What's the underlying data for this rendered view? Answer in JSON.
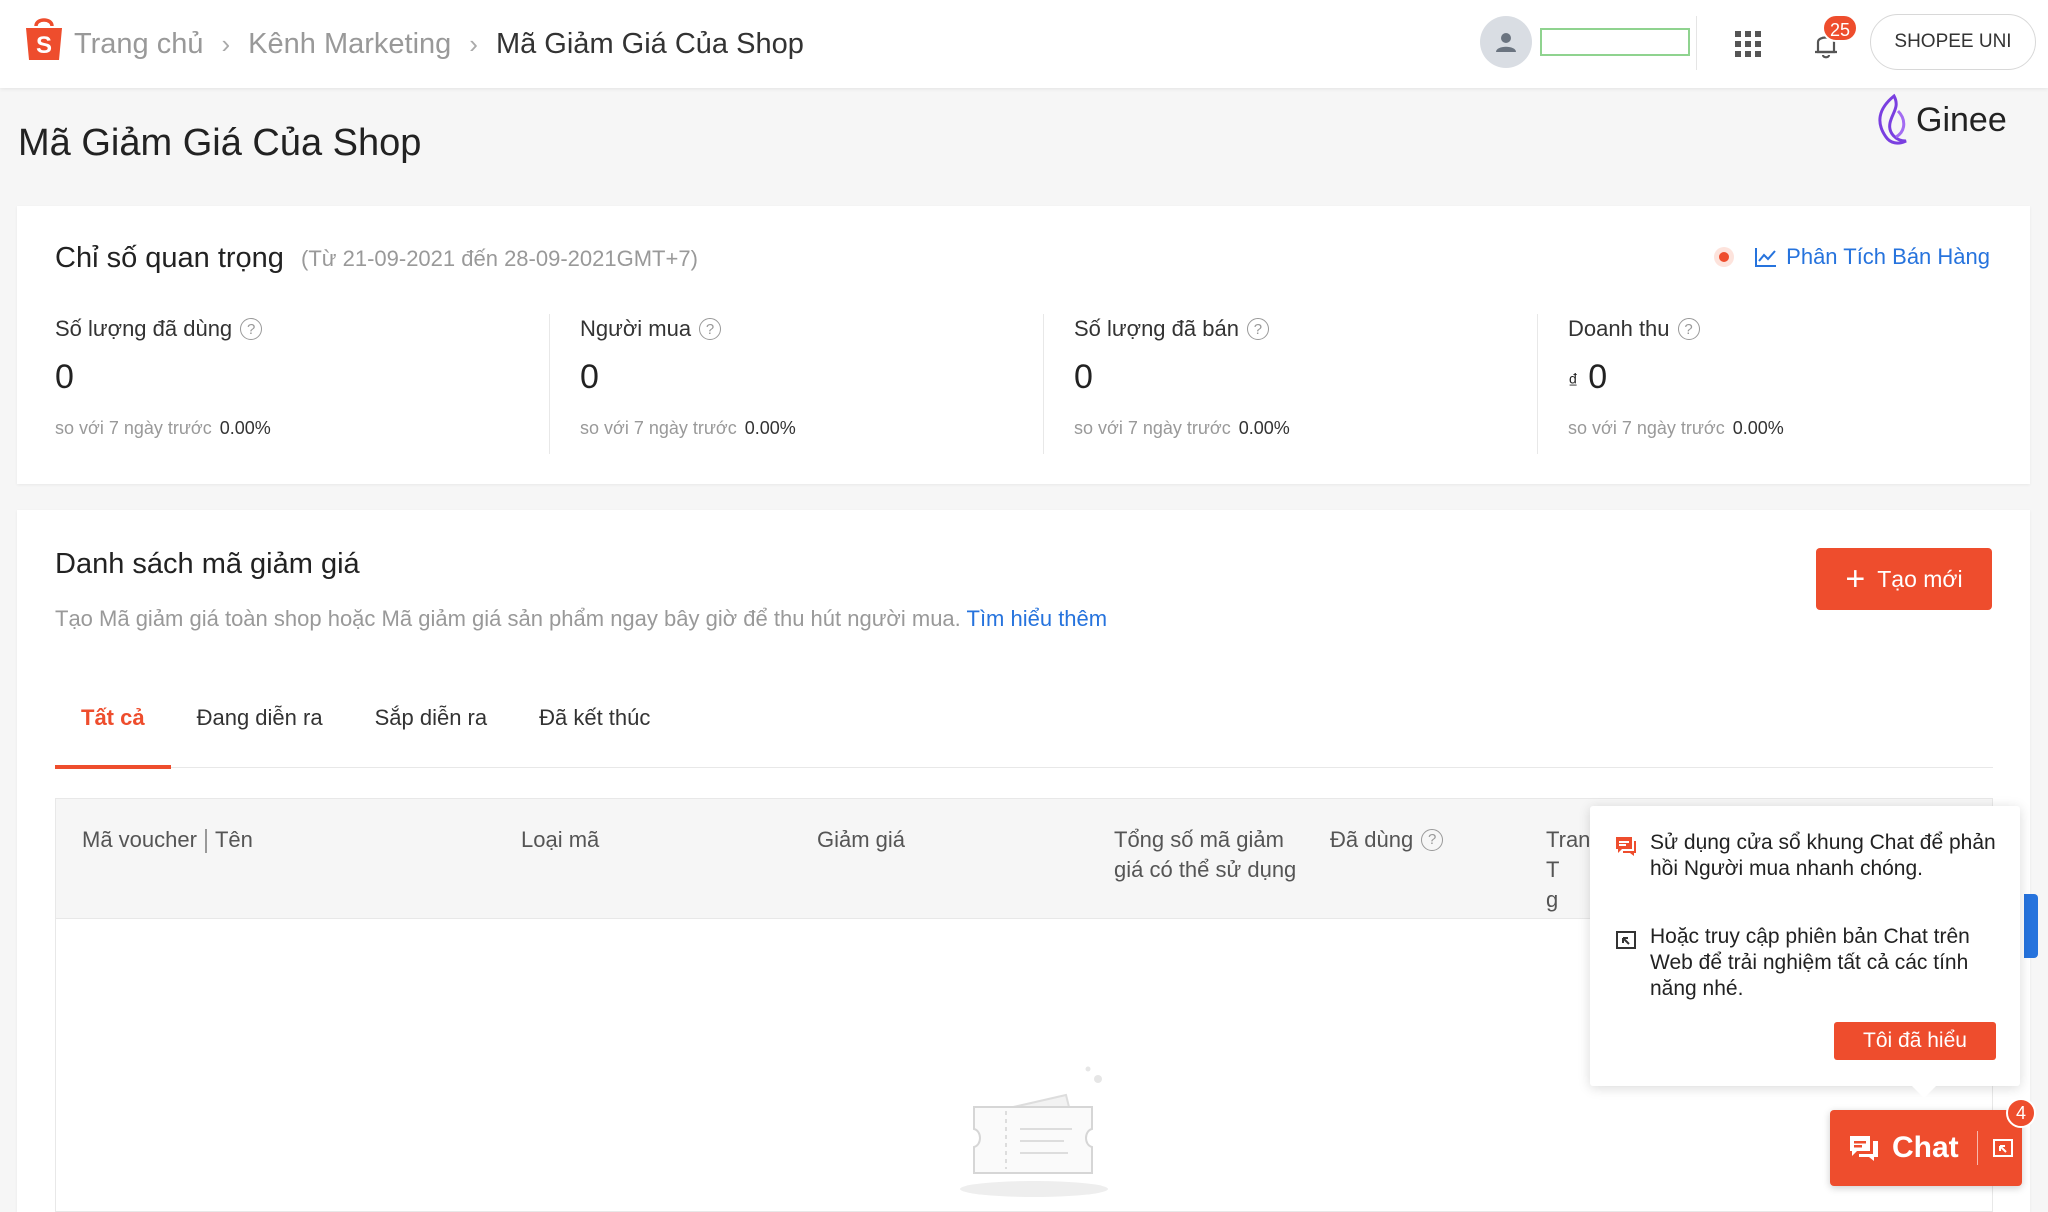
{
  "header": {
    "breadcrumbs": [
      "Trang chủ",
      "Kênh Marketing",
      "Mã Giảm Giá Của Shop"
    ],
    "notification_count": "25",
    "uni_button": "SHOPEE UNI"
  },
  "brand": {
    "ginee": "Ginee"
  },
  "page": {
    "title": "Mã Giảm Giá Của Shop"
  },
  "metrics": {
    "title": "Chỉ số quan trọng",
    "date_range": "(Từ 21-09-2021 đến 28-09-2021GMT+7)",
    "analytics_link": "Phân Tích Bán Hàng",
    "compare_label": "so với 7 ngày trước",
    "items": [
      {
        "label": "Số lượng đã dùng",
        "value": "0",
        "change": "0.00%"
      },
      {
        "label": "Người mua",
        "value": "0",
        "change": "0.00%"
      },
      {
        "label": "Số lượng đã bán",
        "value": "0",
        "change": "0.00%"
      },
      {
        "label": "Doanh thu",
        "currency": "₫",
        "value": "0",
        "change": "0.00%"
      }
    ]
  },
  "vouchers": {
    "title": "Danh sách mã giảm giá",
    "description": "Tạo Mã giảm giá toàn shop hoặc Mã giảm giá sản phẩm ngay bây giờ để thu hút người mua.",
    "learn_more": "Tìm hiểu thêm",
    "create_button": "Tạo mới",
    "tabs": [
      "Tất cả",
      "Đang diễn ra",
      "Sắp diễn ra",
      "Đã kết thúc"
    ],
    "columns": {
      "code": "Mã voucher",
      "name": "Tên",
      "type": "Loại mã",
      "discount": "Giảm giá",
      "total_line1": "Tổng số mã giảm",
      "total_line2": "giá có thể sử dụng",
      "used": "Đã dùng",
      "status_partial1": "Tran",
      "status_partial2": "T",
      "status_partial3": "g"
    }
  },
  "chat_tip": {
    "line1": "Sử dụng cửa sổ khung Chat để phản hồi Người mua nhanh chóng.",
    "line2": "Hoặc truy cập phiên bản Chat trên Web để trải nghiệm tất cả các tính năng nhé.",
    "ok_button": "Tôi đã hiểu"
  },
  "chat": {
    "label": "Chat",
    "badge": "4"
  },
  "colors": {
    "accent": "#ee4d2d",
    "link": "#2673dd"
  }
}
